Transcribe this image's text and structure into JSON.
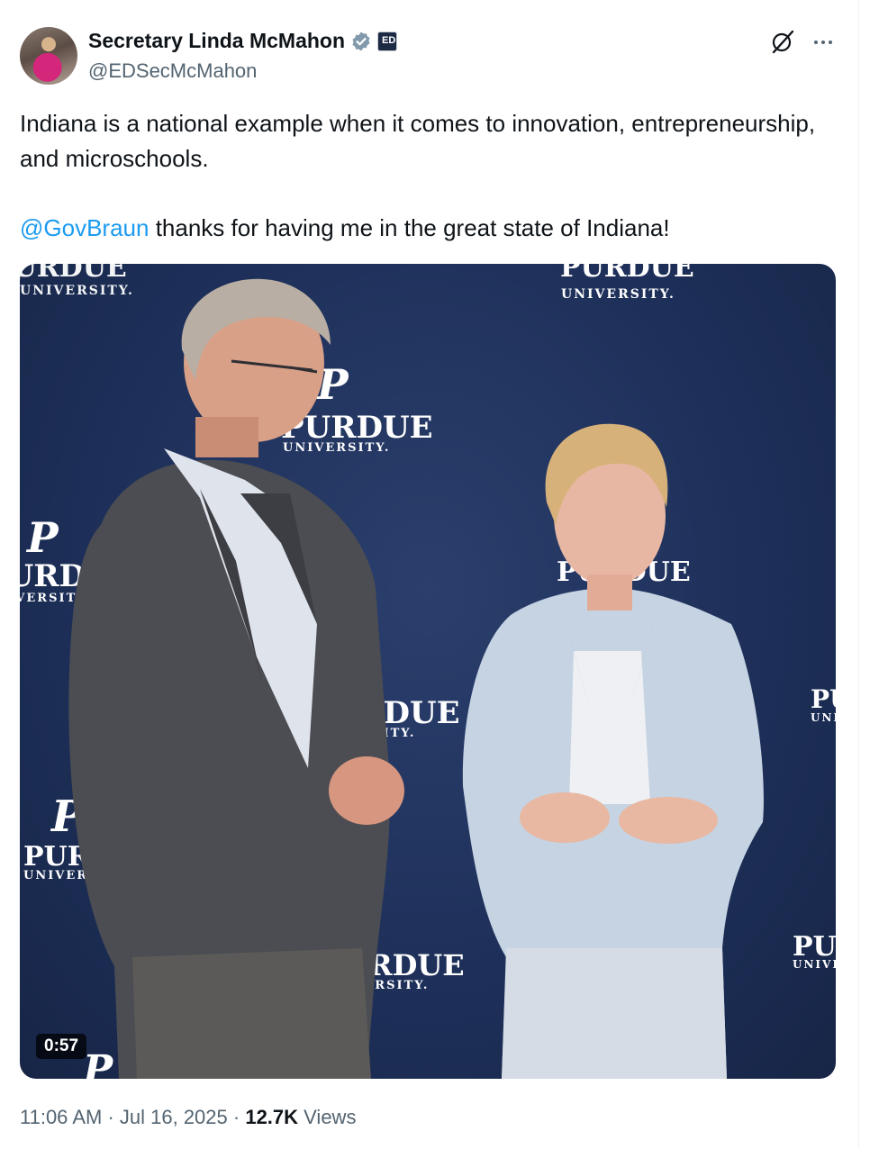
{
  "author": {
    "display_name": "Secretary Linda McMahon",
    "handle": "@EDSecMcMahon",
    "verified_color": "#829aab",
    "affiliation_badge": "ED"
  },
  "tweet": {
    "paragraph1": "Indiana is a national example when it comes to innovation, entrepreneurship, and microschools.",
    "mention": "@GovBraun",
    "paragraph2_rest": " thanks for having me in the great state of Indiana!"
  },
  "media": {
    "duration": "0:57",
    "backdrop_logo_word": "PURDUE",
    "backdrop_logo_sub": "UNIVERSITY.",
    "backdrop_logo_letter": "P"
  },
  "meta": {
    "time": "11:06 AM",
    "separator": " · ",
    "date": "Jul 16, 2025",
    "views_count": "12.7K",
    "views_label": " Views"
  },
  "icons": {
    "grok": "grok-icon",
    "more": "more-icon",
    "verified": "verified-badge-icon"
  },
  "colors": {
    "link": "#1d9bf0",
    "secondary_text": "#536471",
    "backdrop": "#1d2f58"
  }
}
